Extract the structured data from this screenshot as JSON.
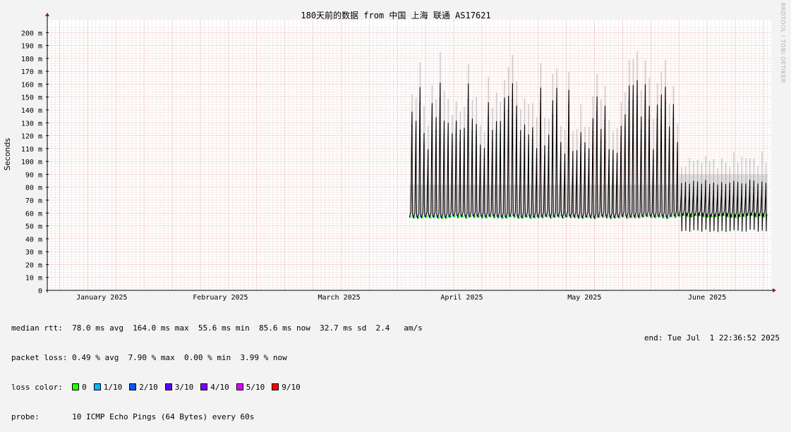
{
  "chart_data": {
    "type": "line",
    "title": "180天前的数据 from 中国 上海 联通 AS17621",
    "ylabel": "Seconds",
    "ylim": [
      0,
      0.21
    ],
    "y_ticks": [
      {
        "value": 0,
        "label": "0"
      },
      {
        "value": 0.01,
        "label": "10 m"
      },
      {
        "value": 0.02,
        "label": "20 m"
      },
      {
        "value": 0.03,
        "label": "30 m"
      },
      {
        "value": 0.04,
        "label": "40 m"
      },
      {
        "value": 0.05,
        "label": "50 m"
      },
      {
        "value": 0.06,
        "label": "60 m"
      },
      {
        "value": 0.07,
        "label": "70 m"
      },
      {
        "value": 0.08,
        "label": "80 m"
      },
      {
        "value": 0.09,
        "label": "90 m"
      },
      {
        "value": 0.1,
        "label": "100 m"
      },
      {
        "value": 0.11,
        "label": "110 m"
      },
      {
        "value": 0.12,
        "label": "120 m"
      },
      {
        "value": 0.13,
        "label": "130 m"
      },
      {
        "value": 0.14,
        "label": "140 m"
      },
      {
        "value": 0.15,
        "label": "150 m"
      },
      {
        "value": 0.16,
        "label": "160 m"
      },
      {
        "value": 0.17,
        "label": "170 m"
      },
      {
        "value": 0.18,
        "label": "180 m"
      },
      {
        "value": 0.19,
        "label": "190 m"
      },
      {
        "value": 0.2,
        "label": "200 m"
      }
    ],
    "x_ticks": [
      "January 2025",
      "February 2025",
      "March 2025",
      "April 2025",
      "May 2025",
      "June 2025"
    ],
    "data_start": "2025-04-03",
    "data_end": "2025-06-30",
    "series": [
      {
        "name": "median rtt",
        "phase": "2025-04-03 to 2025-06-09",
        "baseline": 0.056,
        "daily_peak_range": [
          0.105,
          0.165
        ]
      },
      {
        "name": "median rtt",
        "phase": "2025-06-09 to 2025-06-30",
        "baseline": 0.057,
        "daily_peak_range": [
          0.082,
          0.086
        ]
      }
    ],
    "grid": true,
    "colors": {
      "background": "#f3f3f3",
      "plot_bg": "#ffffff",
      "grid_minor": "#e9c2c2",
      "grid_major": "#d98888",
      "median_line": "#000000",
      "smoke": "#9a9a9a",
      "axis_arrow": "#8b1a1a"
    }
  },
  "stats": {
    "median_rtt": "median rtt:  78.0 ms avg  164.0 ms max  55.6 ms min  85.6 ms now  32.7 ms sd  2.4   am/s",
    "packet_loss": "packet loss: 0.49 % avg  7.90 % max  0.00 % min  3.99 % now",
    "loss_color_label": "loss color:",
    "probe": "probe:       10 ICMP Echo Pings (64 Bytes) every 60s",
    "end": "end: Tue Jul  1 22:36:52 2025"
  },
  "loss_colors": [
    {
      "label": "0",
      "color": "#26ff00"
    },
    {
      "label": "1/10",
      "color": "#00b8ff"
    },
    {
      "label": "2/10",
      "color": "#0059ff"
    },
    {
      "label": "3/10",
      "color": "#5e00ff"
    },
    {
      "label": "4/10",
      "color": "#7e00ff"
    },
    {
      "label": "5/10",
      "color": "#dd00ff"
    },
    {
      "label": "9/10",
      "color": "#ff0000"
    }
  ],
  "watermark": "RRDTOOL / TOBI OETIKER"
}
